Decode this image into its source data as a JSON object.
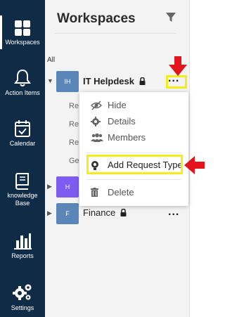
{
  "rail": {
    "items": [
      {
        "label": "Workspaces",
        "icon": "grid-icon"
      },
      {
        "label": "Action Items",
        "icon": "bell-icon"
      },
      {
        "label": "Calendar",
        "icon": "calendar-check-icon"
      },
      {
        "label_line1": "knowledge",
        "label_line2": "Base",
        "icon": "book-icon"
      },
      {
        "label": "Reports",
        "icon": "bar-chart-icon"
      },
      {
        "label": "Settings",
        "icon": "gears-icon"
      }
    ]
  },
  "panel": {
    "title": "Workspaces",
    "all_label": "All",
    "workspaces": [
      {
        "badge": "IH",
        "name": "IT Helpdesk",
        "color": "#5b86b8",
        "dots": "..."
      },
      {
        "badge": "H",
        "color": "#7e5cf2"
      },
      {
        "badge": "F",
        "name": "Finance",
        "color": "#5b86b8",
        "dots": "..."
      }
    ],
    "sub_items": [
      "Re",
      "Re",
      "Re",
      "Ge"
    ]
  },
  "menu": {
    "hide": "Hide",
    "details": "Details",
    "members": "Members",
    "add_request_type": "Add Request Type",
    "delete": "Delete"
  },
  "colors": {
    "rail_bg": "#0f2b46",
    "highlight": "#f5ec1a",
    "arrow": "#e3141b"
  }
}
